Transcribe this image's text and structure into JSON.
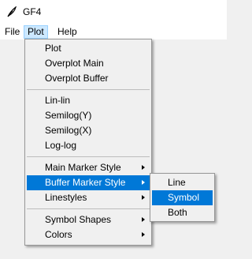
{
  "window": {
    "title": "GF4",
    "icon": "feather-icon"
  },
  "menubar": {
    "items": [
      "File",
      "Plot",
      "Help"
    ]
  },
  "plot_menu": {
    "items": [
      {
        "label": "Plot"
      },
      {
        "label": "Overplot Main"
      },
      {
        "label": "Overplot Buffer"
      },
      {
        "label": "Lin-lin"
      },
      {
        "label": "Semilog(Y)"
      },
      {
        "label": "Semilog(X)"
      },
      {
        "label": "Log-log"
      },
      {
        "label": "Main Marker Style",
        "submenu": true
      },
      {
        "label": "Buffer Marker Style",
        "submenu": true,
        "highlighted": true
      },
      {
        "label": "Linestyles",
        "submenu": true
      },
      {
        "label": "Symbol Shapes",
        "submenu": true
      },
      {
        "label": "Colors",
        "submenu": true
      }
    ]
  },
  "buffer_marker_submenu": {
    "items": [
      {
        "label": "Line"
      },
      {
        "label": "Symbol",
        "highlighted": true
      },
      {
        "label": "Both"
      }
    ]
  },
  "colors": {
    "highlight": "#0078d7",
    "menubar_active": "#cce8ff"
  }
}
